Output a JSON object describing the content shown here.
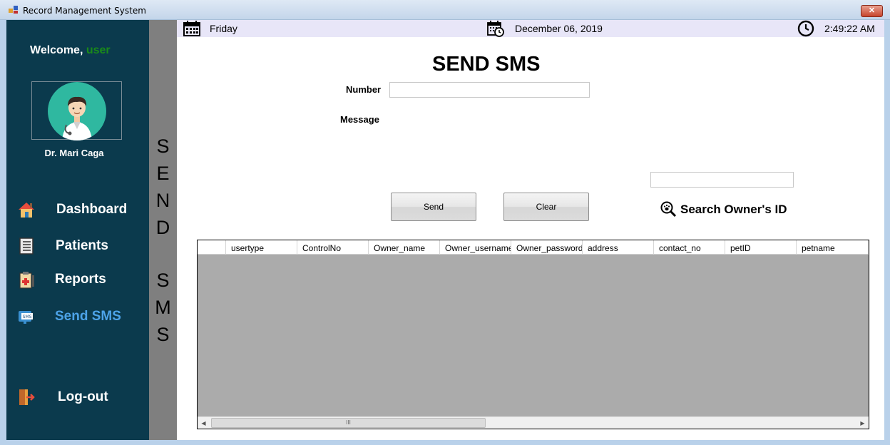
{
  "window": {
    "title": "Record Management System",
    "close_label": "✕"
  },
  "sidebar": {
    "welcome_prefix": "Welcome,",
    "welcome_user": "user",
    "doctor_name": "Dr. Mari Caga",
    "items": [
      {
        "label": "Dashboard",
        "icon": "home-icon"
      },
      {
        "label": "Patients",
        "icon": "list-icon"
      },
      {
        "label": "Reports",
        "icon": "clipboard-icon"
      },
      {
        "label": "Send SMS",
        "icon": "sms-icon",
        "active": true
      },
      {
        "label": "Log-out",
        "icon": "logout-icon"
      }
    ],
    "active_color": "#4da3e8"
  },
  "vertical_title": [
    "S",
    "E",
    "N",
    "D",
    "S",
    "M",
    "S"
  ],
  "topbar": {
    "day": "Friday",
    "date": "December 06, 2019",
    "time": "2:49:22 AM"
  },
  "form": {
    "title": "SEND SMS",
    "number_label": "Number",
    "number_value": "",
    "message_label": "Message",
    "send_label": "Send",
    "clear_label": "Clear",
    "search_value": "",
    "search_label": "Search Owner's ID"
  },
  "table": {
    "columns": [
      "usertype",
      "ControlNo",
      "Owner_name",
      "Owner_username",
      "Owner_password",
      "address",
      "contact_no",
      "petID",
      "petname"
    ],
    "rows": [],
    "scroll_thumb": "III"
  },
  "colors": {
    "sidebar_bg": "#0b3a4d",
    "strip_bg": "#7f7f7f",
    "grid_bg": "#ababab",
    "topbar_bg": "#e8e6f8"
  }
}
